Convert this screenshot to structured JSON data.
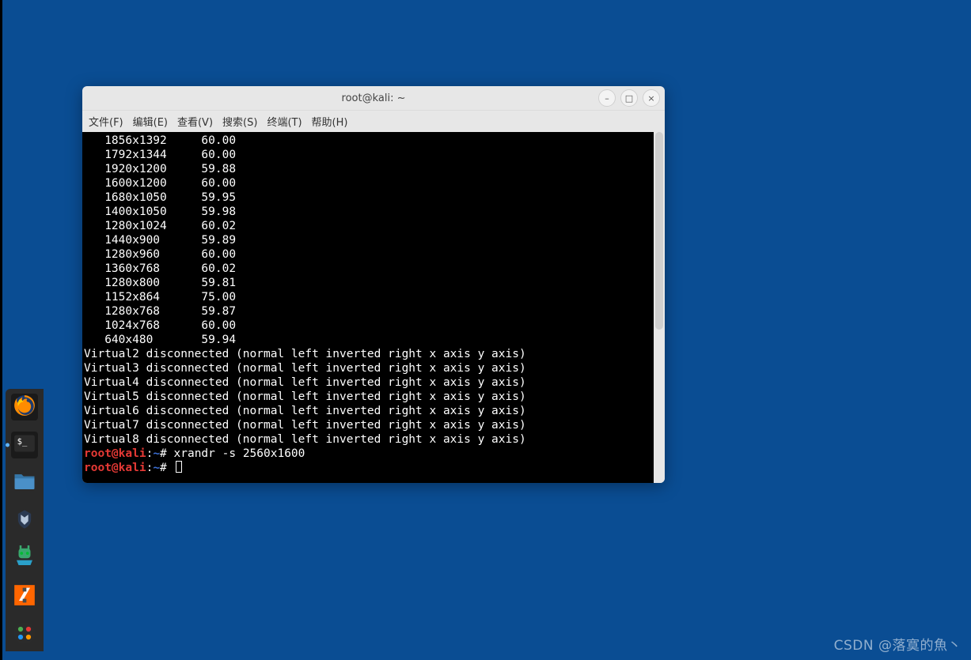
{
  "desktop": {
    "watermark": "CSDN @落寞的魚丶"
  },
  "dock": {
    "items": [
      {
        "name": "firefox",
        "bg": "#1a1a1a"
      },
      {
        "name": "terminal",
        "bg": "#1a1a1a",
        "active": true
      },
      {
        "name": "files",
        "bg": "transparent"
      },
      {
        "name": "metasploit",
        "bg": "transparent"
      },
      {
        "name": "user-tool",
        "bg": "transparent"
      },
      {
        "name": "burpsuite",
        "bg": "transparent"
      },
      {
        "name": "apps",
        "bg": "transparent"
      }
    ]
  },
  "window": {
    "title": "root@kali: ~",
    "controls": {
      "min": "–",
      "max": "□",
      "close": "×"
    },
    "menus": [
      "文件(F)",
      "编辑(E)",
      "查看(V)",
      "搜索(S)",
      "终端(T)",
      "帮助(H)"
    ]
  },
  "terminal": {
    "modes": [
      {
        "res": "1856x1392",
        "hz": "60.00"
      },
      {
        "res": "1792x1344",
        "hz": "60.00"
      },
      {
        "res": "1920x1200",
        "hz": "59.88"
      },
      {
        "res": "1600x1200",
        "hz": "60.00"
      },
      {
        "res": "1680x1050",
        "hz": "59.95"
      },
      {
        "res": "1400x1050",
        "hz": "59.98"
      },
      {
        "res": "1280x1024",
        "hz": "60.02"
      },
      {
        "res": "1440x900",
        "hz": "59.89"
      },
      {
        "res": "1280x960",
        "hz": "60.00"
      },
      {
        "res": "1360x768",
        "hz": "60.02"
      },
      {
        "res": "1280x800",
        "hz": "59.81"
      },
      {
        "res": "1152x864",
        "hz": "75.00"
      },
      {
        "res": "1280x768",
        "hz": "59.87"
      },
      {
        "res": "1024x768",
        "hz": "60.00"
      },
      {
        "res": "640x480",
        "hz": "59.94"
      }
    ],
    "outputs": [
      "Virtual2 disconnected (normal left inverted right x axis y axis)",
      "Virtual3 disconnected (normal left inverted right x axis y axis)",
      "Virtual4 disconnected (normal left inverted right x axis y axis)",
      "Virtual5 disconnected (normal left inverted right x axis y axis)",
      "Virtual6 disconnected (normal left inverted right x axis y axis)",
      "Virtual7 disconnected (normal left inverted right x axis y axis)",
      "Virtual8 disconnected (normal left inverted right x axis y axis)"
    ],
    "prompt": {
      "user": "root@kali",
      "sep": ":",
      "path": "~",
      "hash": "#"
    },
    "last_command": "xrandr -s 2560x1600"
  }
}
